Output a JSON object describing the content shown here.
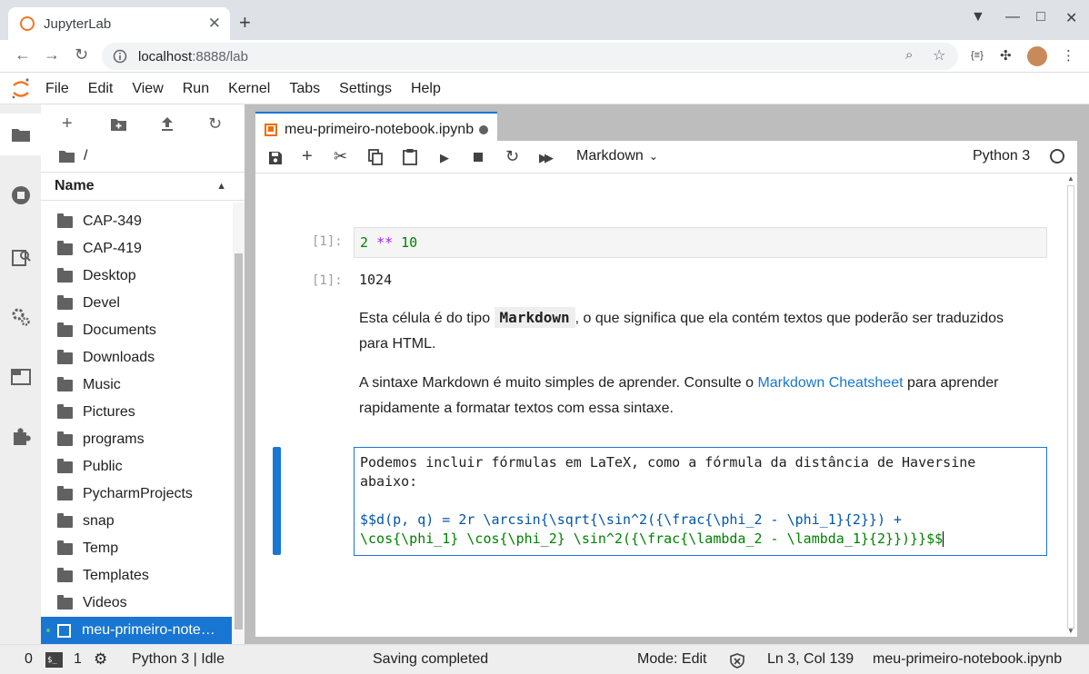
{
  "browser": {
    "tab_title": "JupyterLab",
    "tab_close": "✕",
    "new_tab": "+",
    "url_host": "localhost",
    "url_path": ":8888/lab"
  },
  "menubar": [
    "File",
    "Edit",
    "View",
    "Run",
    "Kernel",
    "Tabs",
    "Settings",
    "Help"
  ],
  "filebrowser": {
    "path": "/",
    "column_header": "Name",
    "items": [
      "CAP-349",
      "CAP-419",
      "Desktop",
      "Devel",
      "Documents",
      "Downloads",
      "Music",
      "Pictures",
      "programs",
      "Public",
      "PycharmProjects",
      "snap",
      "Temp",
      "Templates",
      "Videos"
    ],
    "selected_item": "meu-primeiro-note…"
  },
  "notebook": {
    "tab_title": "meu-primeiro-notebook.ipynb",
    "cell_type": "Markdown",
    "kernel": "Python 3",
    "input_prompt": "[1]:",
    "output_prompt": "[1]:",
    "input_code": {
      "a": "2",
      "op": "**",
      "b": "10"
    },
    "output": "1024",
    "md1_pre": "Esta célula é do tipo ",
    "md1_code": "Markdown",
    "md1_post": ", o que significa que ela contém textos que poderão ser traduzidos para HTML.",
    "md2_pre": "A sintaxe Markdown é muito simples de aprender. Consulte o ",
    "md2_link": "Markdown Cheatsheet",
    "md2_post": " para aprender rapidamente a formatar textos com essa sintaxe.",
    "editor_line1": "Podemos incluir fórmulas em LaTeX, como a fórmula da distância de Haversine",
    "editor_line2": "abaixo:",
    "editor_line4": "$$d(p, q) = 2r \\arcsin{\\sqrt{\\sin^2({\\frac{\\phi_2 - \\phi_1}{2}}) +",
    "editor_line5": "\\cos{\\phi_1} \\cos{\\phi_2} \\sin^2({\\frac{\\lambda_2 - \\lambda_1}{2}})}}$$"
  },
  "statusbar": {
    "terminals": "0",
    "kernels": "1",
    "kernel_status": "Python 3 | Idle",
    "message": "Saving completed",
    "mode": "Mode: Edit",
    "position": "Ln 3, Col 139",
    "filename": "meu-primeiro-notebook.ipynb"
  }
}
